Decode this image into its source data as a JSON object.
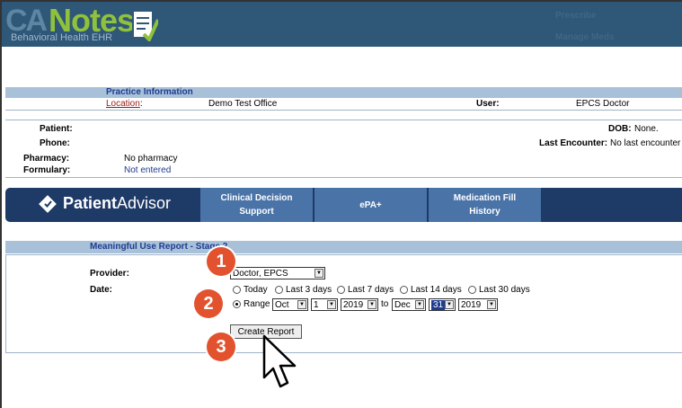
{
  "header": {
    "logo_ca": "CA",
    "logo_notes": "Notes",
    "logo_sub": "Behavioral Health EHR",
    "links": [
      "Prescribe",
      "Manage Meds"
    ]
  },
  "practice": {
    "title": "Practice Information",
    "location_label": "Location",
    "location_value": "Demo Test Office",
    "user_label": "User:",
    "user_value": "EPCS Doctor"
  },
  "patient": {
    "patient_label": "Patient:",
    "phone_label": "Phone:",
    "pharmacy_label": "Pharmacy:",
    "pharmacy_value": "No pharmacy",
    "formulary_label": "Formulary:",
    "formulary_value": "Not entered",
    "dob_label": "DOB:",
    "dob_value": "None.",
    "last_enc_label": "Last Encounter:",
    "last_enc_value": "No last encounter"
  },
  "nav": {
    "brand_bold": "Patient",
    "brand_light": "Advisor",
    "items": [
      {
        "line1": "Clinical Decision",
        "line2": "Support"
      },
      {
        "line1": "ePA+",
        "line2": ""
      },
      {
        "line1": "Medication Fill",
        "line2": "History"
      }
    ]
  },
  "report": {
    "title": "Meaningful Use Report - Stage 2",
    "provider_label": "Provider:",
    "provider_value": "Doctor, EPCS",
    "date_label": "Date:",
    "ranges": [
      "Today",
      "Last 3 days",
      "Last 7 days",
      "Last 14 days",
      "Last 30 days"
    ],
    "range_label": "Range",
    "from_month": "Oct",
    "from_day": "1",
    "from_year": "2019",
    "to_label": "to",
    "to_month": "Dec",
    "to_day": "31",
    "to_year": "2019",
    "button": "Create Report"
  },
  "steps": [
    "1",
    "2",
    "3"
  ]
}
